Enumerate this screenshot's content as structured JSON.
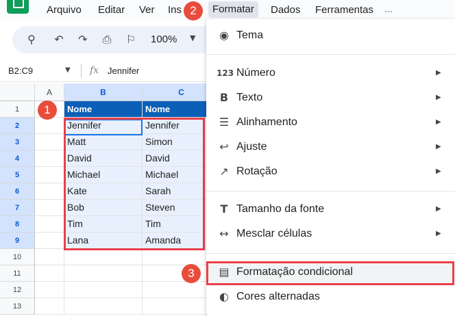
{
  "menubar": {
    "items": [
      "Arquivo",
      "Editar",
      "Ver",
      "Ins",
      "Formatar",
      "Dados",
      "Ferramentas",
      "···"
    ]
  },
  "toolbar": {
    "zoom": "100%",
    "icons": [
      "search-icon",
      "undo-icon",
      "redo-icon",
      "print-icon",
      "paint-format-icon"
    ]
  },
  "formula_bar": {
    "name_box": "B2:C9",
    "fx": "fx",
    "value": "Jennifer"
  },
  "grid": {
    "columns": [
      "A",
      "B",
      "C"
    ],
    "rows": [
      "1",
      "2",
      "3",
      "4",
      "5",
      "6",
      "7",
      "8",
      "9",
      "10",
      "11",
      "12",
      "13"
    ],
    "header": [
      "Nome",
      "Nome"
    ],
    "col_b": [
      "Jennifer",
      "Matt",
      "David",
      "Michael",
      "Kate",
      "Bob",
      "Tim",
      "Lana"
    ],
    "col_c": [
      "Jennifer",
      "Simon",
      "David",
      "Michael",
      "Sarah",
      "Steven",
      "Tim",
      "Amanda"
    ]
  },
  "badges": [
    "1",
    "2",
    "3"
  ],
  "dropdown": {
    "tema": "Tema",
    "numero": "Número",
    "numero_icon": "123",
    "texto": "Texto",
    "alinhamento": "Alinhamento",
    "ajuste": "Ajuste",
    "rotacao": "Rotação",
    "tamanho": "Tamanho da fonte",
    "mesclar": "Mesclar células",
    "condicional": "Formatação condicional",
    "alternadas": "Cores alternadas"
  },
  "colors": {
    "header_fill": "#0b5fb7",
    "selection_fill": "#e8f0fd",
    "highlight_red": "#e8404a"
  }
}
